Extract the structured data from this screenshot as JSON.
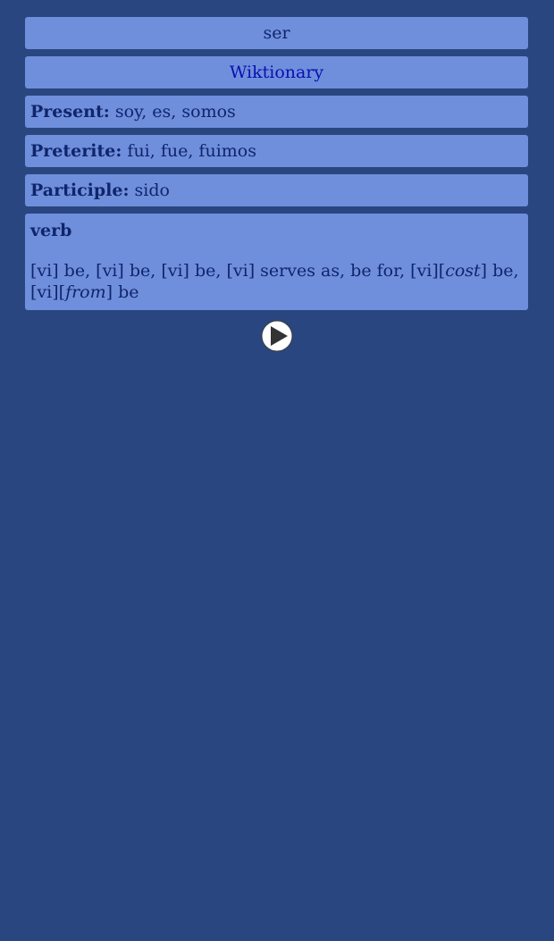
{
  "headword": "ser",
  "link": {
    "label": "Wiktionary"
  },
  "conjugations": [
    {
      "label": "Present:",
      "forms": "soy, es, somos"
    },
    {
      "label": "Preterite:",
      "forms": "fui, fue, fuimos"
    },
    {
      "label": "Participle:",
      "forms": "sido"
    }
  ],
  "definitions": {
    "part_of_speech": "verb",
    "segments": [
      "[vi] be, [vi] be, [vi] be, [vi] serves as, be for, [vi][",
      "cost",
      "] be, [vi][",
      "from",
      "] be"
    ]
  },
  "audio": {
    "icon": "play-icon"
  }
}
